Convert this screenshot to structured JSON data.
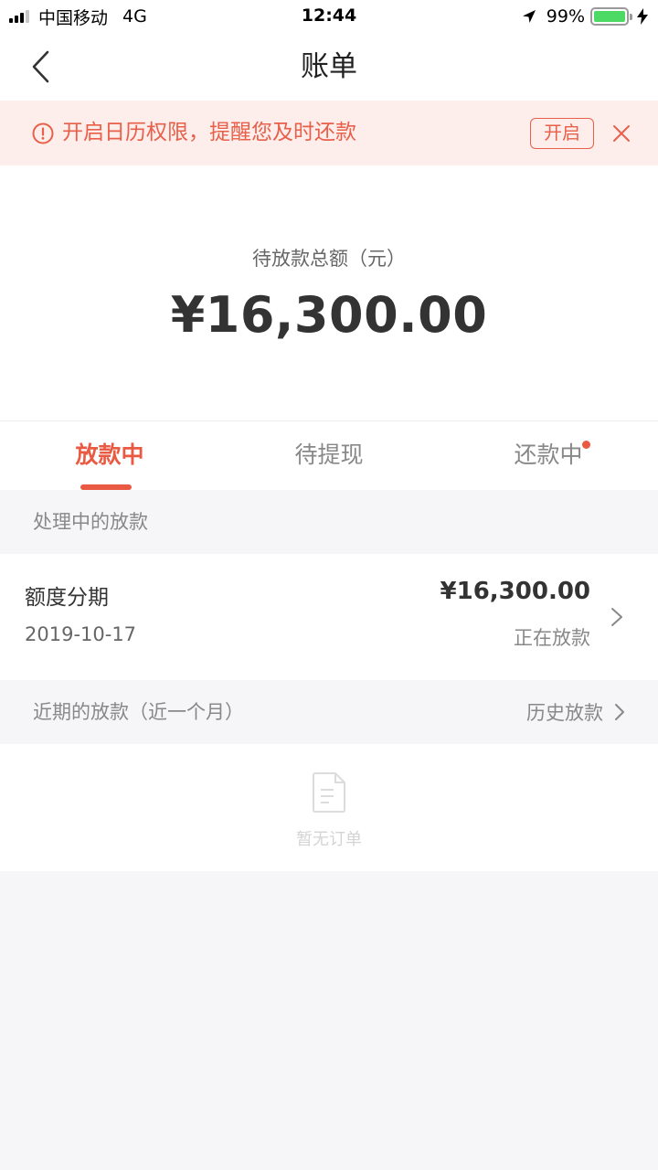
{
  "status_bar": {
    "carrier": "中国移动",
    "network": "4G",
    "time": "12:44",
    "battery": "99%"
  },
  "nav": {
    "title": "账单",
    "back_icon": "chevron-left-icon"
  },
  "notice": {
    "text": "开启日历权限，提醒您及时还款",
    "open_label": "开启",
    "icon": "alert-circle-icon",
    "close_icon": "close-icon"
  },
  "summary": {
    "label": "待放款总额（元）",
    "amount": "¥16,300.00"
  },
  "tabs": [
    {
      "label": "放款中",
      "active": true
    },
    {
      "label": "待提现",
      "active": false
    },
    {
      "label": "还款中",
      "active": false,
      "badge_dot": true
    }
  ],
  "processing": {
    "title": "处理中的放款",
    "items": [
      {
        "name": "额度分期",
        "date": "2019-10-17",
        "amount": "¥16,300.00",
        "status": "正在放款"
      }
    ]
  },
  "recent": {
    "title": "近期的放款（近一个月）",
    "history_label": "历史放款",
    "empty_text": "暂无订单"
  },
  "colors": {
    "accent": "#ea5a43",
    "notice_bg": "#fdeeec",
    "page_bg": "#f6f6f8",
    "battery": "#4cd964"
  }
}
